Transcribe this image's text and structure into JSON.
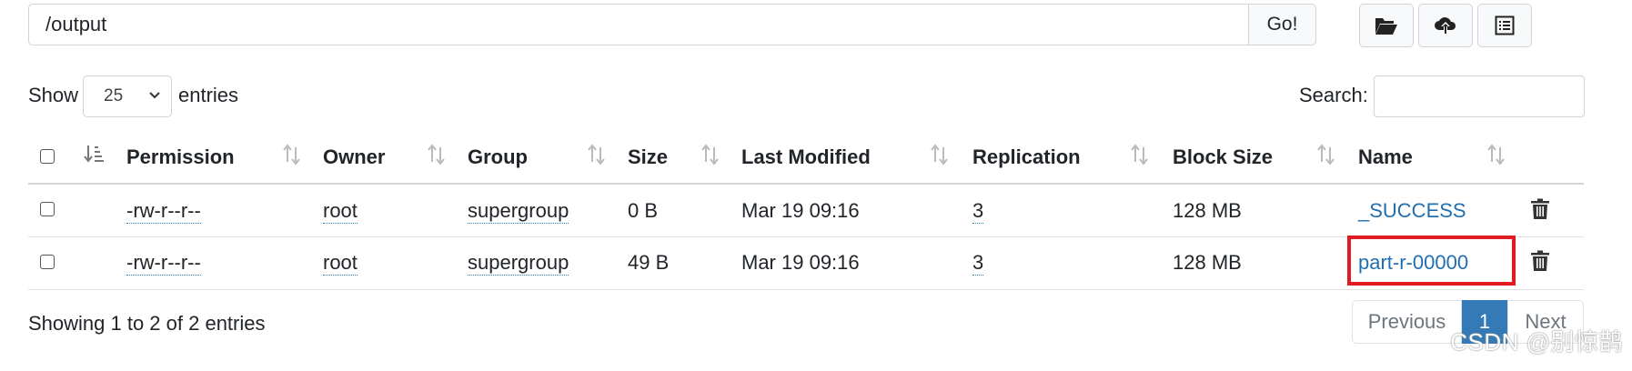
{
  "path_bar": {
    "value": "/output",
    "go_label": "Go!"
  },
  "toolbar": {
    "icons": [
      "folder-open-icon",
      "cloud-upload-icon",
      "list-alt-icon"
    ]
  },
  "length": {
    "show_label": "Show",
    "selected": "25",
    "entries_label": "entries"
  },
  "search": {
    "label": "Search:",
    "value": ""
  },
  "table": {
    "columns": [
      "Permission",
      "Owner",
      "Group",
      "Size",
      "Last Modified",
      "Replication",
      "Block Size",
      "Name"
    ],
    "rows": [
      {
        "permission": "-rw-r--r--",
        "owner": "root",
        "group": "supergroup",
        "size": "0 B",
        "last_modified": "Mar 19 09:16",
        "replication": "3",
        "block_size": "128 MB",
        "name": "_SUCCESS"
      },
      {
        "permission": "-rw-r--r--",
        "owner": "root",
        "group": "supergroup",
        "size": "49 B",
        "last_modified": "Mar 19 09:16",
        "replication": "3",
        "block_size": "128 MB",
        "name": "part-r-00000"
      }
    ]
  },
  "info": "Showing 1 to 2 of 2 entries",
  "pagination": {
    "previous": "Previous",
    "current": "1",
    "next": "Next"
  },
  "highlight_color": "#e01b22",
  "accent_color": "#337ab7",
  "watermark": "CSDN @别惊鹊"
}
